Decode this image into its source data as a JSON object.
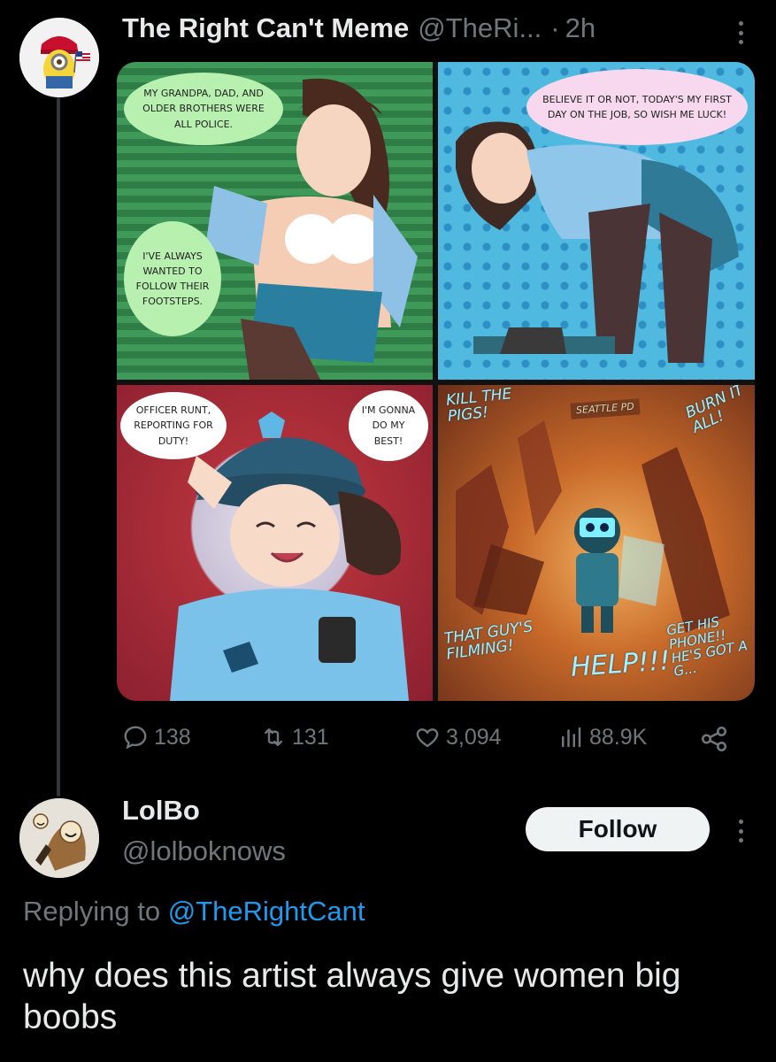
{
  "original_tweet": {
    "display_name": "The Right Can't Meme",
    "handle": "@TheRi...",
    "separator": "·",
    "time": "2h",
    "more_icon": "more-horizontal-icon",
    "avatar_icon": "minion-avatar",
    "comic": {
      "panel1": {
        "bubble_top": "My grandpa, dad, and older brothers were all police.",
        "bubble_bottom": "I've always wanted to follow their footsteps."
      },
      "panel2": {
        "bubble": "Believe it or not, today's my first day on the job, so wish me luck!"
      },
      "panel3": {
        "bubble_left": "Officer Runt, reporting for duty!",
        "bubble_right": "I'm gonna do my best!"
      },
      "panel4": {
        "fx_kill": "Kill the\npigs!",
        "sign": "Seattle PD",
        "fx_burn": "Burn it\nall!",
        "fx_filming": "That guy's\nfilming!",
        "fx_help": "Help!!!",
        "fx_phone": "Get his\nphone!!\nHe's got a g..."
      }
    },
    "stats": {
      "replies": "138",
      "retweets": "131",
      "likes": "3,094",
      "views": "88.9K"
    },
    "icons": {
      "reply": "reply-icon",
      "retweet": "retweet-icon",
      "like": "heart-icon",
      "views": "views-icon",
      "share": "share-icon"
    }
  },
  "reply_tweet": {
    "display_name": "LolBo",
    "handle": "@lolboknows",
    "follow_label": "Follow",
    "replying_prefix": "Replying to ",
    "replying_mention": "@TheRightCant",
    "text": "why does this artist always give women big boobs"
  },
  "colors": {
    "background": "#000000",
    "text_primary": "#e7e9ea",
    "text_secondary": "#71767b",
    "link": "#1d9bf0",
    "follow_bg": "#eff3f4"
  }
}
